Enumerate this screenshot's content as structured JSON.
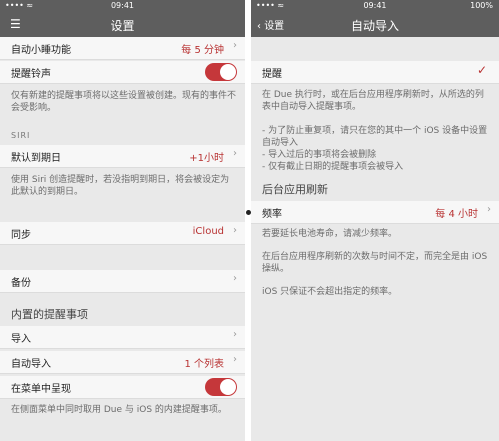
{
  "left": {
    "status": {
      "time": "09:41",
      "left": "•••• ≈",
      "right": ""
    },
    "nav": {
      "title": "设置"
    },
    "rows": {
      "auto_snooze": {
        "label": "自动小睡功能",
        "value": "每 5 分钟"
      },
      "reminder_tone": {
        "label": "提醒铃声"
      },
      "default_date": {
        "label": "默认到期日",
        "value": "+1小时"
      },
      "sync": {
        "label": "同步",
        "value": "iCloud"
      },
      "backup": {
        "label": "备份"
      },
      "import": {
        "label": "导入"
      },
      "auto_import": {
        "label": "自动导入",
        "value": "1 个列表"
      },
      "show_in_menu": {
        "label": "在菜单中呈现"
      }
    },
    "notes": {
      "tone_note": "仅有新建的提醒事项将以这些设置被创建。现有的事件不会受影响。",
      "siri_head": "SIRI",
      "siri_note": "使用 Siri 创造提醒时，若没指明到期日，将会被设定为此默认的到期日。",
      "builtin_head": "内置的提醒事项",
      "menu_note": "在侧面菜单中同时取用 Due 与 iOS 的内建提醒事项。"
    }
  },
  "right": {
    "status": {
      "time": "09:41",
      "left": "•••• ≈",
      "right": "100%"
    },
    "nav": {
      "title": "自动导入",
      "back_label": "设置"
    },
    "reminders": {
      "label": "提醒"
    },
    "note1": "在 Due 执行时，或在后台应用程序刷新时，从所选的列表中自动导入提醒事项。",
    "note2": "- 为了防止重复项，请只在您的其中一个 iOS 设备中设置自动导入\n- 导入过后的事项将会被删除\n- 仅有截止日期的提醒事项会被导入",
    "bg_head": "后台应用刷新",
    "frequency": {
      "label": "频率",
      "value": "每 4 小时"
    },
    "note3": "若要延长电池寿命，请减少频率。",
    "note4": "在后台应用程序刷新的次数与时间不定，而完全是由 iOS 操纵。",
    "note5": "iOS 只保证不会超出指定的频率。"
  },
  "icons": {
    "chevron": "›",
    "check": "✓",
    "menu": "☰",
    "back": "‹"
  },
  "colors": {
    "accent": "#b83232",
    "toggle_on": "#c5373a",
    "navbar": "#5e5e5e"
  }
}
